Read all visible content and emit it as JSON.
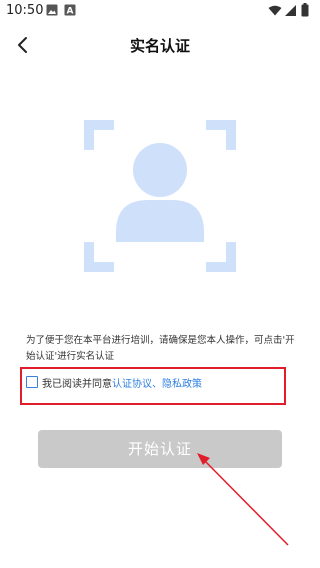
{
  "status_bar": {
    "time": "10:50",
    "icons": [
      "image-icon",
      "text-a-icon",
      "wifi-icon",
      "cellular-icon",
      "battery-icon"
    ]
  },
  "header": {
    "back_icon": "chevron-left-icon",
    "title": "实名认证"
  },
  "illustration": {
    "icon": "face-scan-icon",
    "color": "#cfe0fb"
  },
  "notice": {
    "text": "为了便于您在本平台进行培训，请确保是您本人操作，可点击'开始认证'进行实名认证"
  },
  "agreement": {
    "checked": false,
    "prefix": "我已阅读并同意",
    "link_terms": "认证协议",
    "separator": "、",
    "link_privacy": "隐私政策"
  },
  "start_button": {
    "label": "开始认证",
    "disabled_color": "#c9c9c9"
  },
  "colors": {
    "accent": "#2f7fe0",
    "highlight_red": "#e21d2b"
  }
}
